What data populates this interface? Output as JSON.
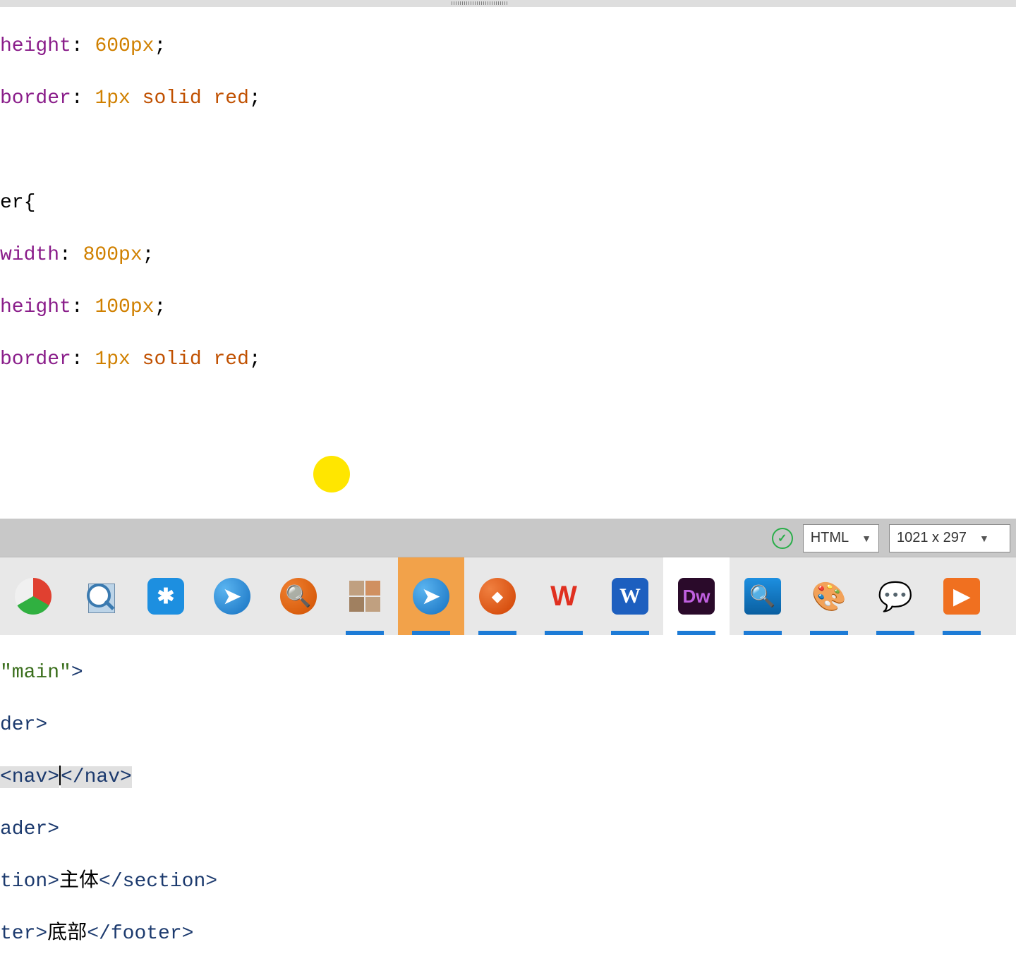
{
  "code": {
    "l1a": "height",
    "l1b": ": ",
    "l1c": "600px",
    "l1d": ";",
    "l2a": "border",
    "l2b": ": ",
    "l2c": "1px",
    "l2d": " ",
    "l2e": "solid",
    "l2f": " ",
    "l2g": "red",
    "l2h": ";",
    "l3": "",
    "l4a": "er{",
    "l4": "",
    "l5a": "width",
    "l5b": ": ",
    "l5c": "800px",
    "l5d": ";",
    "l6a": "height",
    "l6b": ": ",
    "l6c": "100px",
    "l6d": ";",
    "l7a": "border",
    "l7b": ": ",
    "l7c": "1px",
    "l7d": " ",
    "l7e": "solid",
    "l7f": " ",
    "l7g": "red",
    "l7h": ";",
    "l13a": "\"main\"",
    "l13b": ">",
    "l14a": "der>",
    "l14": "",
    "l15a": "<nav>",
    "l15b": "</nav>",
    "l16a": "ader>",
    "l16": "",
    "l17a": "tion>",
    "l17b": "主体",
    "l17c": "</section>",
    "l18a": "ter>",
    "l18b": "底部",
    "l18c": "</footer>"
  },
  "status": {
    "language": "HTML",
    "dimensions": "1021 x 297"
  },
  "taskbar": {
    "items": [
      {
        "name": "tuji"
      },
      {
        "name": "page-viewer"
      },
      {
        "name": "star-app"
      },
      {
        "name": "dingtalk-1"
      },
      {
        "name": "everything-search"
      },
      {
        "name": "photos"
      },
      {
        "name": "dingtalk-2"
      },
      {
        "name": "diamond-app"
      },
      {
        "name": "wps-office"
      },
      {
        "name": "microsoft-word"
      },
      {
        "name": "dreamweaver"
      },
      {
        "name": "image-viewer"
      },
      {
        "name": "paint"
      },
      {
        "name": "wechat"
      },
      {
        "name": "video-player"
      }
    ]
  }
}
